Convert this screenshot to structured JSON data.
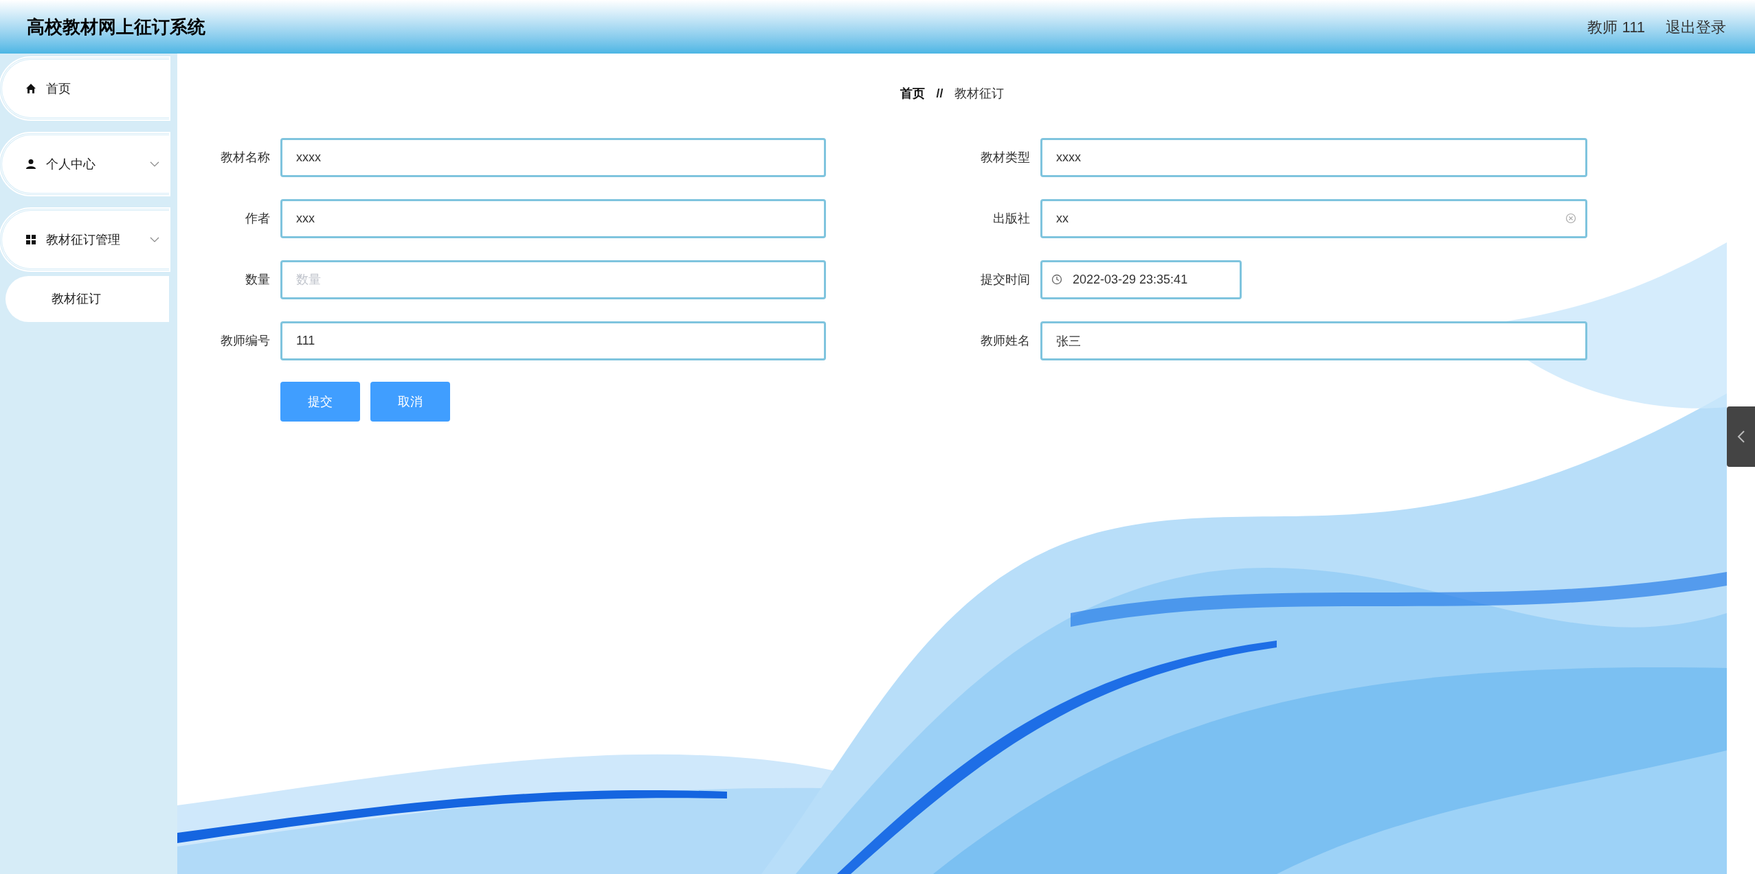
{
  "header": {
    "title": "高校教材网上征订系统",
    "user": "教师 111",
    "logout": "退出登录"
  },
  "sidebar": {
    "items": [
      {
        "label": "首页",
        "kind": "home"
      },
      {
        "label": "个人中心",
        "kind": "person",
        "expandable": true
      },
      {
        "label": "教材征订管理",
        "kind": "group",
        "expandable": true,
        "children": [
          {
            "label": "教材征订"
          }
        ]
      }
    ]
  },
  "breadcrumb": {
    "items": [
      "首页",
      "教材征订"
    ],
    "separator": "//"
  },
  "form": {
    "left_fields": [
      {
        "label": "教材名称",
        "kind": "text",
        "value": "xxxx"
      },
      {
        "label": "作者",
        "kind": "text",
        "value": "xxx"
      },
      {
        "label": "数量",
        "kind": "text",
        "placeholder": "数量"
      },
      {
        "label": "教师编号",
        "kind": "text",
        "value": "111"
      }
    ],
    "right_fields": [
      {
        "label": "教材类型",
        "kind": "text",
        "value": "xxxx"
      },
      {
        "label": "出版社",
        "kind": "text",
        "value": "xx",
        "focused": true
      },
      {
        "label": "提交时间",
        "kind": "datetime",
        "value": "2022-03-29 23:35:41"
      },
      {
        "label": "教师姓名",
        "kind": "text",
        "value": "张三"
      }
    ],
    "buttons": [
      "提交",
      "取消"
    ]
  }
}
